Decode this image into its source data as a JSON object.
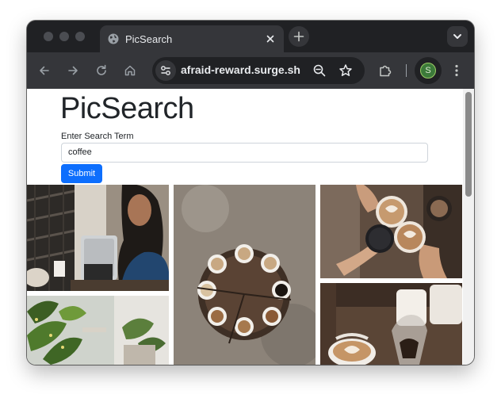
{
  "browser": {
    "tab_title": "PicSearch",
    "url": "afraid-reward.surge.sh",
    "profile_initial": "S",
    "theme_colors": {
      "frame": "#202124",
      "toolbar": "#35363a",
      "text": "#e8eaed"
    },
    "icons": [
      "globe-icon",
      "close-icon",
      "plus-icon",
      "chevron-down-icon",
      "back-arrow-icon",
      "forward-arrow-icon",
      "reload-icon",
      "home-icon",
      "tune-icon",
      "zoom-out-icon",
      "star-icon",
      "puzzle-icon",
      "kebab-menu-icon"
    ]
  },
  "page": {
    "heading": "PicSearch",
    "search_label": "Enter Search Term",
    "search_value": "coffee",
    "submit_label": "Submit",
    "accent": "#0d6efd",
    "results": [
      {
        "subject": "woman smiling at laptop in cafe"
      },
      {
        "subject": "overhead view of coffee cups on round wooden table"
      },
      {
        "subject": "hands toasting cappuccinos"
      },
      {
        "subject": "green potted plants"
      },
      {
        "subject": "latte art cups with glass carafe"
      }
    ]
  }
}
